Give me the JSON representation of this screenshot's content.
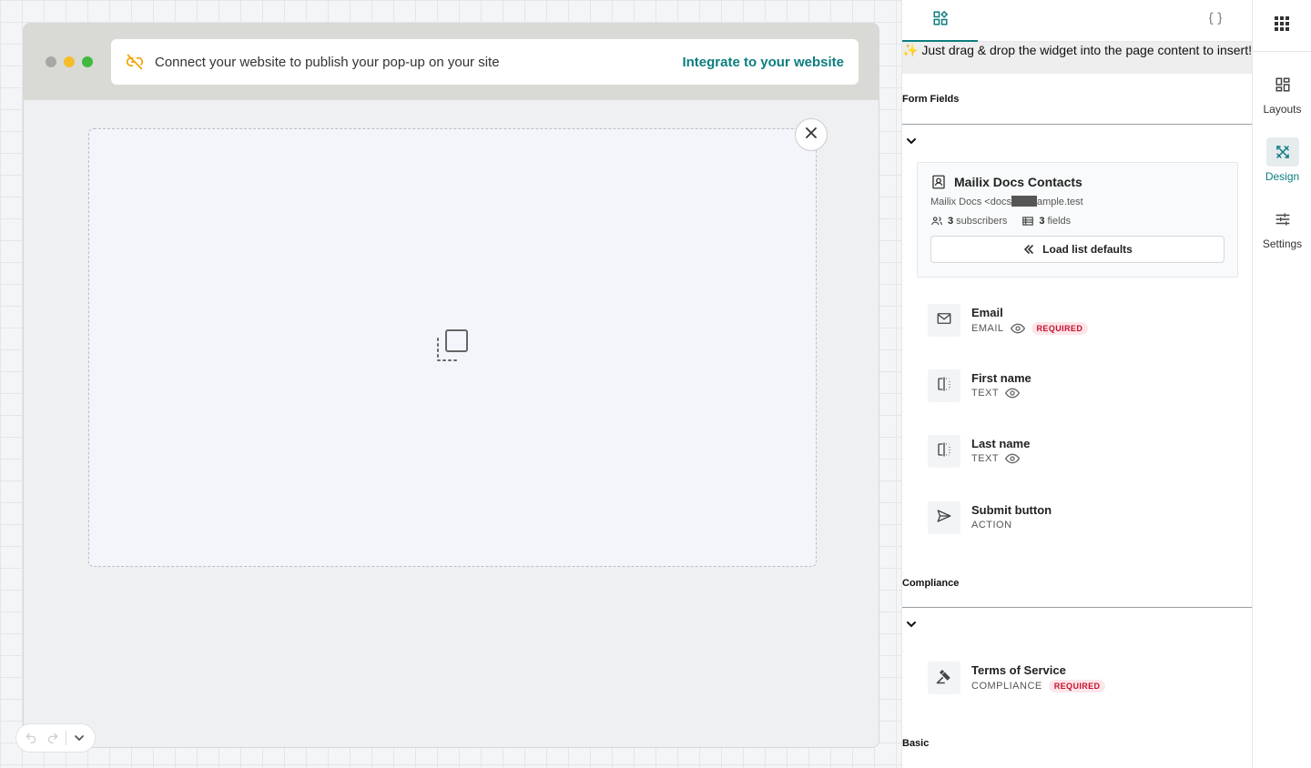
{
  "canvas": {
    "url_bar": {
      "message": "Connect your website to publish your pop-up on your site",
      "link_label": "Integrate to your website"
    }
  },
  "panel": {
    "hint": "✨ Just drag & drop the widget into the page content to insert!",
    "sections": {
      "form_fields": "Form Fields",
      "compliance": "Compliance",
      "basic": "Basic"
    },
    "list_card": {
      "title": "Mailix Docs Contacts",
      "sender_prefix": "Mailix Docs <docs",
      "sender_suffix": "ample.test",
      "subscribers_count": "3",
      "subscribers_label": "subscribers",
      "fields_count": "3",
      "fields_label": "fields",
      "load_button": "Load list defaults"
    },
    "fields": [
      {
        "name": "Email",
        "type": "EMAIL",
        "required": "REQUIRED"
      },
      {
        "name": "First name",
        "type": "TEXT"
      },
      {
        "name": "Last name",
        "type": "TEXT"
      },
      {
        "name": "Submit button",
        "type": "ACTION"
      }
    ],
    "compliance_fields": [
      {
        "name": "Terms of Service",
        "type": "COMPLIANCE",
        "required": "REQUIRED"
      }
    ]
  },
  "rail": {
    "items": [
      {
        "label": "Layouts"
      },
      {
        "label": "Design"
      },
      {
        "label": "Settings"
      }
    ],
    "active": "Design"
  },
  "colors": {
    "accent": "#0d7d7f",
    "required_text": "#c8102e",
    "required_bg": "#fde6ea",
    "warning_icon": "#f4a100"
  }
}
